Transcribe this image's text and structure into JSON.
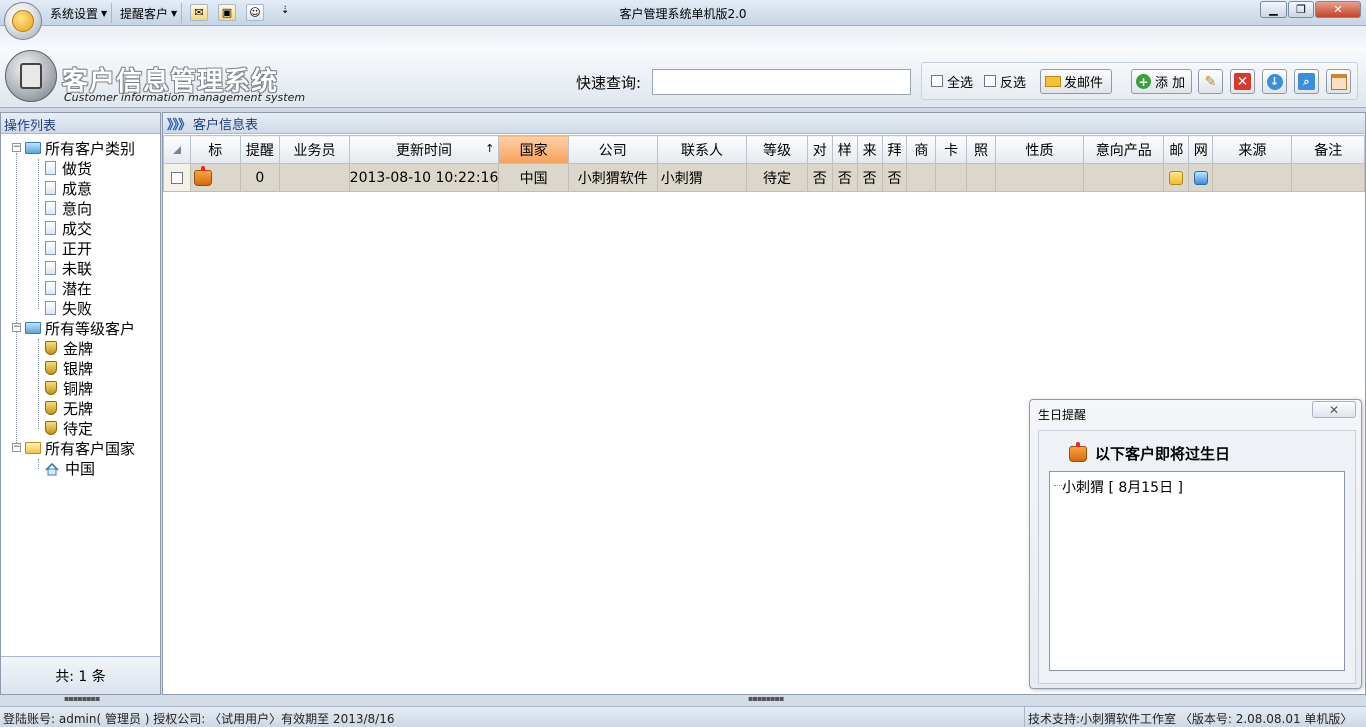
{
  "titlebar": {
    "app_title": "客户管理系统单机版2.0",
    "menu_system": "系统设置",
    "menu_reminder": "提醒客户",
    "minimize": "▁",
    "maximize": "❐",
    "close": "✕"
  },
  "header": {
    "logo_title": "客户信息管理系统",
    "logo_subtitle": "Customer information management system",
    "search_label": "快速查询:",
    "search_value": "",
    "select_all_label": "全选",
    "invert_select_label": "反选",
    "send_mail_label": "发邮件",
    "add_label": "添 加"
  },
  "left_panel": {
    "heading": "操作列表",
    "groups": [
      {
        "label": "所有客户类别",
        "icon": "folder-blue-icon",
        "items": [
          "做货",
          "成意",
          "意向",
          "成交",
          "正开",
          "未联",
          "潜在",
          "失败"
        ]
      },
      {
        "label": "所有等级客户",
        "icon": "folder-blue-icon",
        "items": [
          "金牌",
          "银牌",
          "铜牌",
          "无牌",
          "待定"
        ]
      },
      {
        "label": "所有客户国家",
        "icon": "folder-yellow-icon",
        "items": [
          "中国"
        ]
      }
    ],
    "footer": "共: 1 条"
  },
  "main_panel": {
    "heading": "客户信息表",
    "columns": [
      "标",
      "提醒",
      "业务员",
      "更新时间",
      "国家",
      "公司",
      "联系人",
      "等级",
      "对",
      "样",
      "来",
      "拜",
      "商",
      "卡",
      "照",
      "性质",
      "意向产品",
      "邮",
      "网",
      "来源",
      "备注"
    ],
    "sort_indicator": "↑",
    "rows": [
      {
        "reminder": "0",
        "salesperson": "",
        "updated": "2013-08-10 10:22:16",
        "country": "中国",
        "company": "小刺猬软件",
        "contact": "小刺猬",
        "level": "待定",
        "dui": "否",
        "yang": "否",
        "lai": "否",
        "bai": "否",
        "shang": "",
        "ka": "",
        "zhao": "",
        "nature": "",
        "product": "",
        "source": "",
        "notes": ""
      }
    ]
  },
  "birthday_popup": {
    "title": "生日提醒",
    "heading": "以下客户即将过生日",
    "entry": "小刺猬 [ 8月15日 ]",
    "close_glyph": "✕"
  },
  "statusbar": {
    "left": "登陆账号: admin( 管理员 ) 授权公司: 〈试用用户〉有效期至 2013/8/16",
    "right": "技术支持:小刺猬软件工作室 〈版本号: 2.08.08.01 单机版〉"
  },
  "colors": {
    "sorted_header": "#f6a25c",
    "selected_row": "#dcd7cc",
    "heading_text": "#1d3e82"
  }
}
